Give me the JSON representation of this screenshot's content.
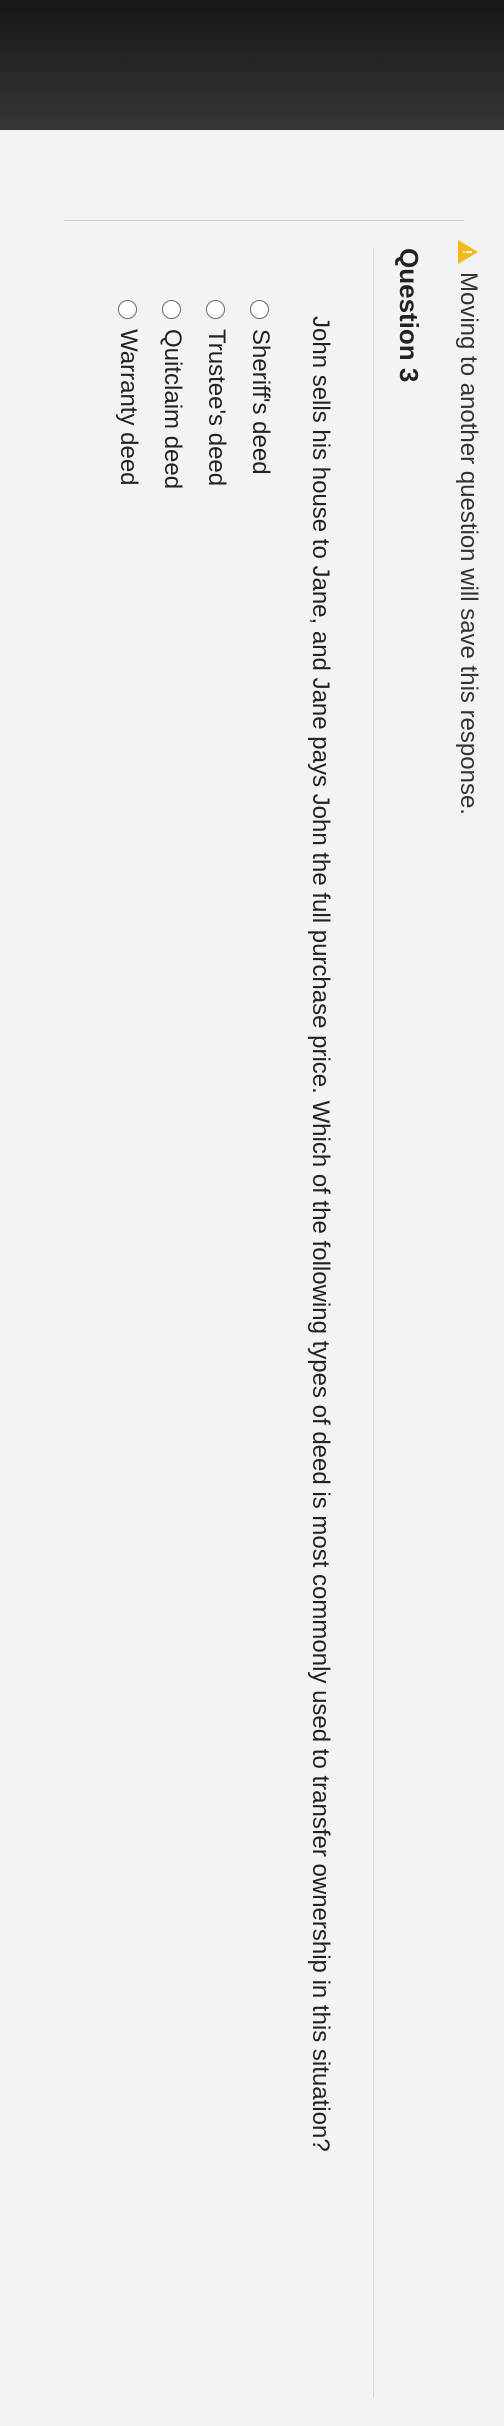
{
  "warning": {
    "icon": "warning-icon",
    "text": "Moving to another question will save this response."
  },
  "question": {
    "title": "Question 3",
    "text": "John sells his house to Jane, and Jane pays John the full purchase price. Which of the following types of deed is most commonly used to transfer ownership in this situation?",
    "options": [
      "Sheriff's deed",
      "Trustee's deed",
      "Quitclaim deed",
      "Warranty deed"
    ]
  }
}
